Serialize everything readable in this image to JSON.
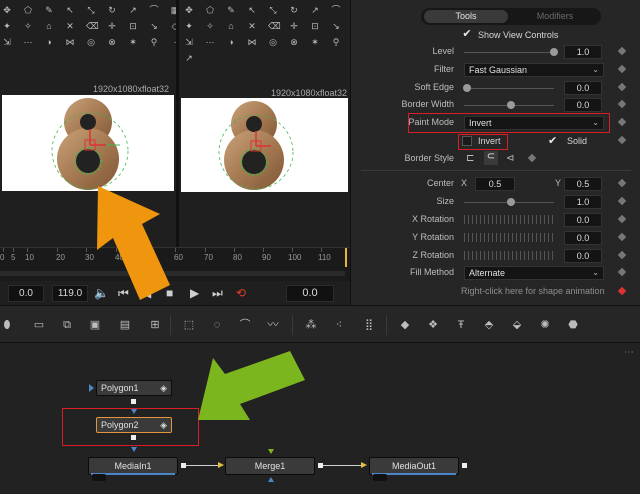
{
  "viewer": {
    "left_resolution": "1920x1080xfloat32",
    "right_resolution": "1920x1080xfloat32"
  },
  "ruler": {
    "ticks": [
      "0",
      "5",
      "10",
      "20",
      "30",
      "40",
      "50",
      "60",
      "70",
      "80",
      "90",
      "100",
      "110"
    ]
  },
  "transport": {
    "start_frame": "0.0",
    "end_frame": "119.0",
    "current_frame": "0.0"
  },
  "inspector": {
    "tabs": {
      "tools": "Tools",
      "modifiers": "Modifiers"
    },
    "show_view_controls": "Show View Controls",
    "level": {
      "label": "Level",
      "value": "1.0",
      "fraction": 1.0
    },
    "filter": {
      "label": "Filter",
      "value": "Fast Gaussian"
    },
    "soft_edge": {
      "label": "Soft Edge",
      "value": "0.0",
      "fraction": 0.0
    },
    "border_width": {
      "label": "Border Width",
      "value": "0.0",
      "fraction": 0.5
    },
    "paint_mode": {
      "label": "Paint Mode",
      "value": "Invert"
    },
    "invert_label": "Invert",
    "solid_label": "Solid",
    "border_style_label": "Border Style",
    "center": {
      "label": "Center",
      "x_label": "X",
      "x_value": "0.5",
      "y_label": "Y",
      "y_value": "0.5"
    },
    "size": {
      "label": "Size",
      "value": "1.0",
      "fraction": 0.5
    },
    "x_rotation": {
      "label": "X Rotation",
      "value": "0.0"
    },
    "y_rotation": {
      "label": "Y Rotation",
      "value": "0.0"
    },
    "z_rotation": {
      "label": "Z Rotation",
      "value": "0.0"
    },
    "fill_method": {
      "label": "Fill Method",
      "value": "Alternate"
    },
    "hint": "Right-click here for shape animation"
  },
  "nodes": {
    "polygon1": "Polygon1",
    "polygon2": "Polygon2",
    "mediain1": "MediaIn1",
    "merge1": "Merge1",
    "mediaout1": "MediaOut1"
  },
  "colors": {
    "highlight_red": "#d81f26",
    "arrow_orange": "#f0960e",
    "arrow_green": "#7cb61e",
    "accent_blue": "#4a86c8"
  }
}
